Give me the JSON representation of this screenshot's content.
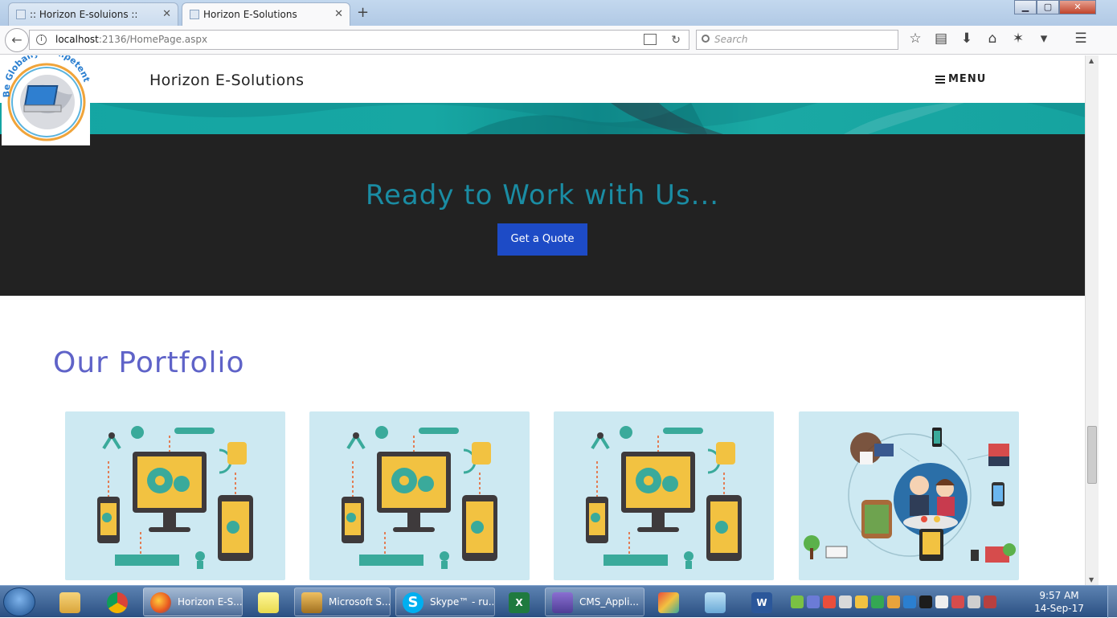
{
  "browser": {
    "tabs": [
      {
        "title": ":: Horizon E-soluions ::",
        "active": false
      },
      {
        "title": "Horizon E-Solutions",
        "active": true
      }
    ],
    "url_host": "localhost",
    "url_path": ":2136/HomePage.aspx",
    "search_placeholder": "Search"
  },
  "site": {
    "logo_text": "Be Globally Competent",
    "brand": "Horizon E-Solutions",
    "menu_label": "MENU",
    "cta_title": "Ready to Work with Us...",
    "cta_button": "Get a Quote",
    "portfolio_title": "Our Portfolio",
    "colors": {
      "accent_teal": "#1a8ca3",
      "button_blue": "#1d4bc6",
      "portfolio_title": "#5f63c8",
      "dark_band": "#222222"
    }
  },
  "taskbar": {
    "items": [
      {
        "label": "",
        "icon": "folder-icon"
      },
      {
        "label": "",
        "icon": "chrome-icon"
      },
      {
        "label": "Horizon E-S...",
        "icon": "firefox-icon"
      },
      {
        "label": "",
        "icon": "notes-icon"
      },
      {
        "label": "Microsoft S...",
        "icon": "sql-server-icon"
      },
      {
        "label": "Skype™ - ru...",
        "icon": "skype-icon"
      },
      {
        "label": "",
        "icon": "excel-icon"
      },
      {
        "label": "CMS_Appli...",
        "icon": "visual-studio-icon"
      },
      {
        "label": "",
        "icon": "tool-icon"
      },
      {
        "label": "",
        "icon": "notepad-icon"
      },
      {
        "label": "",
        "icon": "word-icon"
      }
    ],
    "time": "9:57 AM",
    "date": "14-Sep-17"
  }
}
